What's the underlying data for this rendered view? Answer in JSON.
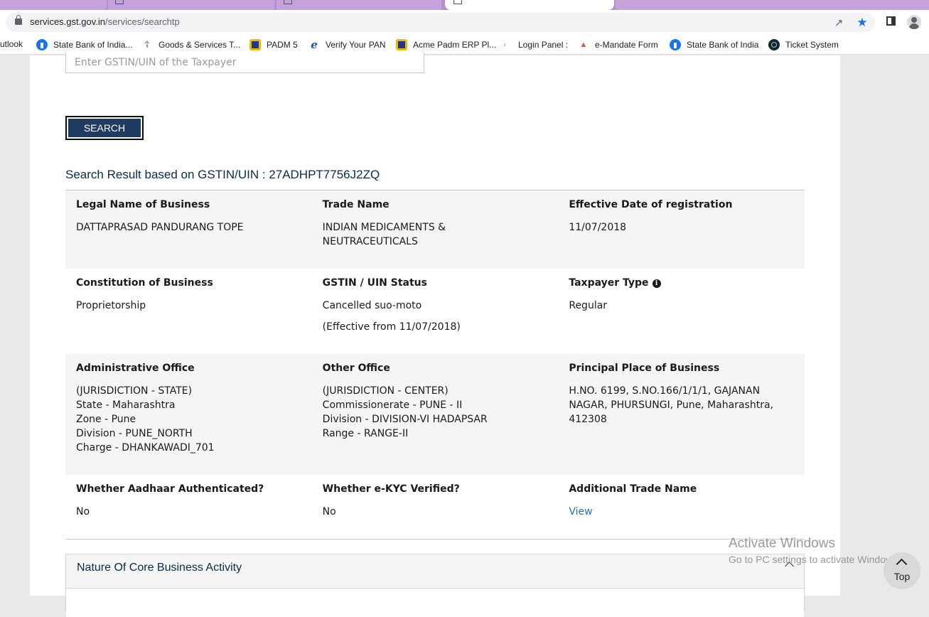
{
  "browser": {
    "url_host": "services.gst.gov.in",
    "url_path": "/services/searchtp",
    "bookmarks": [
      {
        "label": "utlook",
        "icon": "none"
      },
      {
        "label": "State Bank of India...",
        "icon": "sbi-icon"
      },
      {
        "label": "Goods & Services T...",
        "icon": "gst-emblem-icon"
      },
      {
        "label": "PADM 5",
        "icon": "padm-icon"
      },
      {
        "label": "Verify Your PAN",
        "icon": "ie-icon"
      },
      {
        "label": "Acme Padm ERP Pl...",
        "icon": "padm-icon"
      },
      {
        "label": "Login Panel :",
        "icon": "login-icon"
      },
      {
        "label": "e-Mandate Form",
        "icon": "mandate-icon"
      },
      {
        "label": "State Bank of India",
        "icon": "sbi-icon"
      },
      {
        "label": "Ticket System",
        "icon": "react-icon"
      }
    ]
  },
  "search": {
    "placeholder": "Enter GSTIN/UIN of the Taxpayer",
    "button_label": "SEARCH"
  },
  "result": {
    "title": "Search Result based on GSTIN/UIN : 27ADHPT7756J2ZQ",
    "legal_name": {
      "label": "Legal Name of Business",
      "value": "DATTAPRASAD PANDURANG TOPE"
    },
    "trade_name": {
      "label": "Trade Name",
      "value_line1": "INDIAN MEDICAMENTS &",
      "value_line2": "NEUTRACEUTICALS"
    },
    "effective_date": {
      "label": "Effective Date of registration",
      "value": "11/07/2018"
    },
    "constitution": {
      "label": "Constitution of Business",
      "value": "Proprietorship"
    },
    "status": {
      "label": "GSTIN / UIN Status",
      "value": "Cancelled suo-moto",
      "effective": "(Effective from 11/07/2018)"
    },
    "taxpayer_type": {
      "label": "Taxpayer Type",
      "value": "Regular"
    },
    "admin_office": {
      "label": "Administrative Office",
      "lines": [
        "(JURISDICTION - STATE)",
        "State - Maharashtra",
        "Zone - Pune",
        "Division - PUNE_NORTH",
        "Charge - DHANKAWADI_701"
      ]
    },
    "other_office": {
      "label": "Other Office",
      "lines": [
        "(JURISDICTION - CENTER)",
        "Commissionerate - PUNE - II",
        "Division - DIVISION-VI HADAPSAR",
        "Range - RANGE-II"
      ]
    },
    "principal_place": {
      "label": "Principal Place of Business",
      "lines": [
        "H.NO. 6199, S.NO.166/1/1/1, GAJANAN",
        "NAGAR, PHURSUNGI, Pune, Maharashtra,",
        "412308"
      ]
    },
    "aadhaar": {
      "label": "Whether Aadhaar Authenticated?",
      "value": "No"
    },
    "ekyc": {
      "label": "Whether e-KYC Verified?",
      "value": "No"
    },
    "additional_trade": {
      "label": "Additional Trade Name",
      "link": "View"
    }
  },
  "core_activity": {
    "heading": "Nature Of Core Business Activity"
  },
  "watermark": {
    "line1": "Activate Windows",
    "line2": "Go to PC settings to activate Windows."
  },
  "scroll_top": {
    "label": "Top"
  }
}
